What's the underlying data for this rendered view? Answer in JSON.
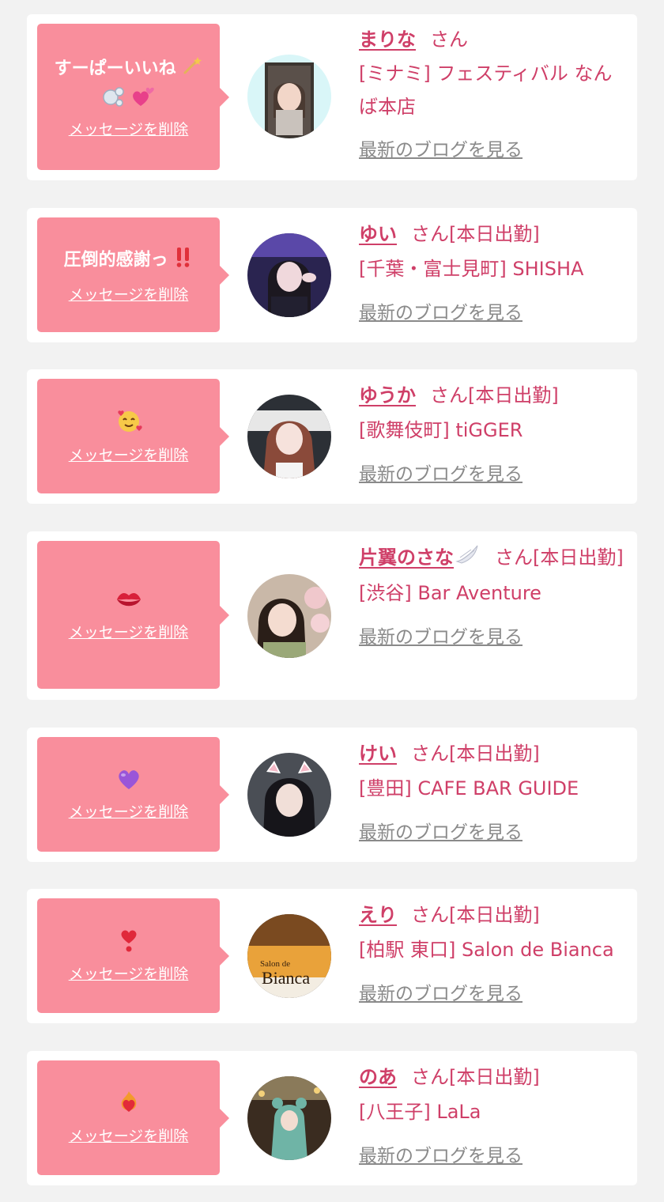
{
  "common": {
    "delete_label": "メッセージを削除",
    "blog_label": "最新のブログを見る",
    "san_suffix": "さん",
    "shift_label": "[本日出勤]"
  },
  "colors": {
    "bubble": "#f98e9c",
    "name": "#cf3f68",
    "link_gray": "#8a8a8a",
    "background": "#f2f2f2"
  },
  "messages": [
    {
      "message": "すーぱーいいね",
      "emoji_icons": [
        "magic-wand-icon",
        "bubbles-icon",
        "two-hearts-icon"
      ],
      "name": "まりな",
      "suffix": "さん",
      "shop": "[ミナミ] フェスティバル なんば本店"
    },
    {
      "message": "圧倒的感謝っ",
      "emoji_icons": [
        "double-exclamation-icon"
      ],
      "name": "ゆい",
      "suffix": "さん[本日出勤]",
      "shop": "[千葉・富士見町] SHISHA"
    },
    {
      "message": "",
      "emoji_icons": [
        "smiling-face-with-hearts-icon"
      ],
      "name": "ゆうか",
      "suffix": "さん[本日出勤]",
      "shop": "[歌舞伎町] tiGGER"
    },
    {
      "message": "",
      "emoji_icons": [
        "kiss-mark-icon"
      ],
      "name": "片翼のさな",
      "name_icon": "wing-icon",
      "suffix": "さん[本日出勤]",
      "shop": "[渋谷] Bar Aventure"
    },
    {
      "message": "",
      "emoji_icons": [
        "purple-heart-icon"
      ],
      "name": "けい",
      "suffix": "さん[本日出勤]",
      "shop": "[豊田] CAFE BAR GUIDE"
    },
    {
      "message": "",
      "emoji_icons": [
        "heart-exclamation-icon"
      ],
      "name": "えり",
      "suffix": "さん[本日出勤]",
      "shop": "[柏駅 東口] Salon de Bianca",
      "avatar_text": [
        "Salon de",
        "Bianca"
      ]
    },
    {
      "message": "",
      "emoji_icons": [
        "heart-on-fire-icon"
      ],
      "name": "のあ",
      "suffix": "さん[本日出勤]",
      "shop": "[八王子] LaLa"
    }
  ]
}
